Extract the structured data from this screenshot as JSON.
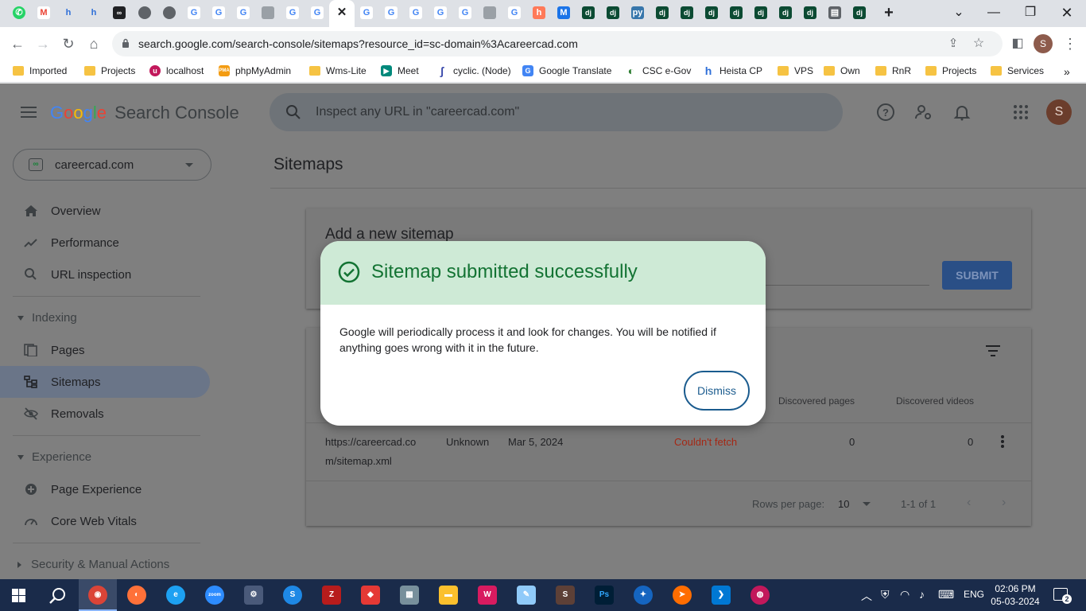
{
  "browser": {
    "address_url": "search.google.com/search-console/sitemaps?resource_id=sc-domain%3Acareercad.com",
    "tab_favicons": [
      "whatsapp",
      "gmail",
      "heista",
      "heista",
      "cyclic",
      "globe",
      "globe",
      "google",
      "google",
      "google",
      "network",
      "google",
      "google",
      "close",
      "google",
      "google",
      "google",
      "google",
      "google",
      "network",
      "google",
      "hubspot",
      "miro",
      "django",
      "django",
      "python",
      "django",
      "django",
      "django",
      "django",
      "django",
      "django",
      "django",
      "sheet",
      "django"
    ],
    "profile_initial": "S"
  },
  "bookmarks": [
    {
      "label": "Imported",
      "icon": "folder"
    },
    {
      "label": "Projects",
      "icon": "folder"
    },
    {
      "label": "localhost",
      "icon": "localhost"
    },
    {
      "label": "phpMyAdmin",
      "icon": "pma"
    },
    {
      "label": "Wms-Lite",
      "icon": "folder"
    },
    {
      "label": "Meet",
      "icon": "meet"
    },
    {
      "label": "cyclic. (Node)",
      "icon": "cyclic"
    },
    {
      "label": "Google Translate",
      "icon": "translate"
    },
    {
      "label": "CSC e-Gov",
      "icon": "csc"
    },
    {
      "label": "Heista CP",
      "icon": "heista"
    },
    {
      "label": "VPS",
      "icon": "folder"
    },
    {
      "label": "Own",
      "icon": "folder"
    },
    {
      "label": "RnR",
      "icon": "folder"
    },
    {
      "label": "Projects",
      "icon": "folder"
    },
    {
      "label": "Services",
      "icon": "folder"
    }
  ],
  "gsc": {
    "logo_google": [
      "G",
      "o",
      "o",
      "g",
      "l",
      "e"
    ],
    "logo_product": "Search Console",
    "search_placeholder": "Inspect any URL in \"careercad.com\"",
    "avatar_initial": "S",
    "property": "careercad.com",
    "nav": {
      "overview": "Overview",
      "performance": "Performance",
      "url_inspection": "URL inspection",
      "indexing": "Indexing",
      "pages": "Pages",
      "sitemaps": "Sitemaps",
      "removals": "Removals",
      "experience": "Experience",
      "page_experience": "Page Experience",
      "core_web_vitals": "Core Web Vitals",
      "security": "Security & Manual Actions"
    },
    "page_title": "Sitemaps",
    "add_sitemap_title": "Add a new sitemap",
    "submit_label": "SUBMIT",
    "table": {
      "headers": {
        "discovered_pages": "Discovered pages",
        "discovered_videos": "Discovered videos"
      },
      "rows": [
        {
          "url_line1": "https://careercad.co",
          "url_line2": "m/sitemap.xml",
          "type": "Unknown",
          "submitted": "Mar 5, 2024",
          "status": "Couldn't fetch",
          "pages": "0",
          "videos": "0"
        }
      ],
      "rows_per_page_label": "Rows per page:",
      "rows_per_page_value": "10",
      "range": "1-1 of 1"
    }
  },
  "modal": {
    "title": "Sitemap submitted successfully",
    "body": "Google will periodically process it and look for changes. You will be notified if anything goes wrong with it in the future.",
    "dismiss": "Dismiss",
    "header_color": "#ceead6",
    "title_color": "#137333"
  },
  "taskbar": {
    "time": "02:06 PM",
    "date": "05-03-2024",
    "language": "ENG",
    "notification_count": "2"
  }
}
